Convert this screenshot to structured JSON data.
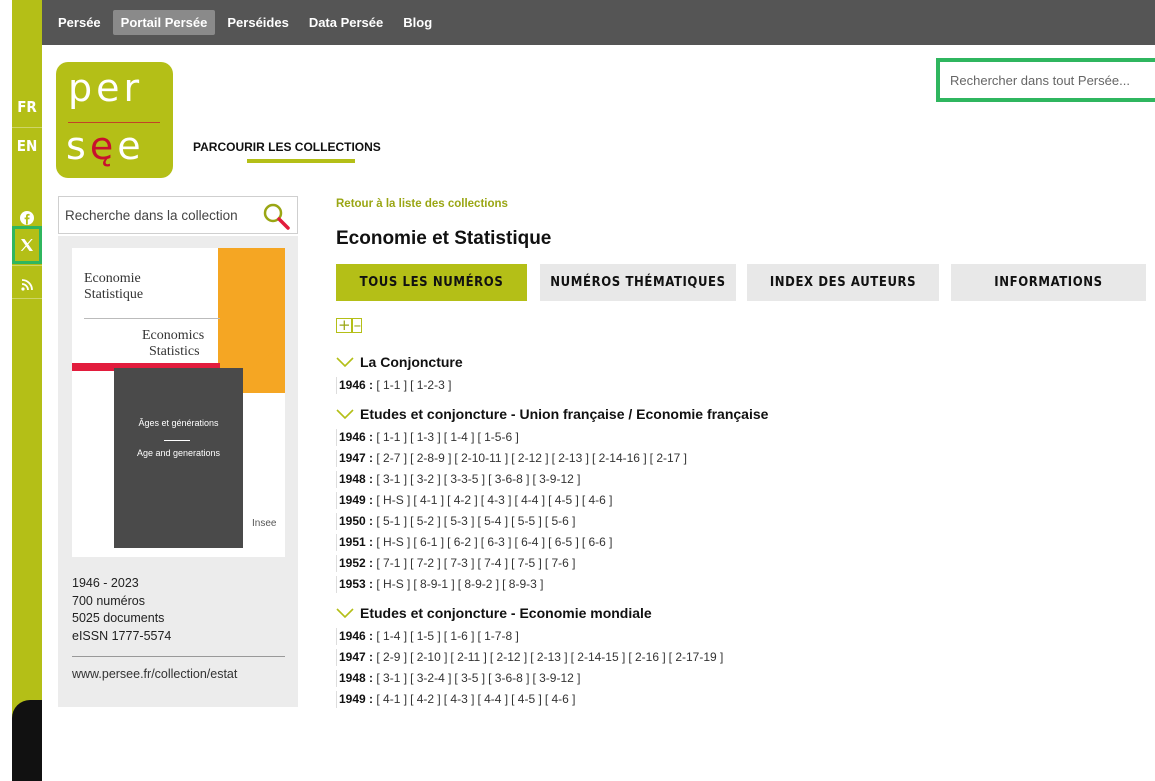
{
  "rail": {
    "lang_fr": "FR",
    "lang_en": "EN"
  },
  "topnav": [
    "Persée",
    "Portail Persée",
    "Perséides",
    "Data Persée",
    "Blog"
  ],
  "logo": {
    "line1": "per",
    "line2_a": "s",
    "line2_b": "ę",
    "line2_c": "e"
  },
  "browse_label": "PARCOURIR LES COLLECTIONS",
  "global_search_placeholder": "Rechercher dans tout Persée...",
  "collection_search_placeholder": "Recherche dans la collection",
  "cover": {
    "title_fr_1": "Economie",
    "title_fr_2": "Statistique",
    "title_en_1": "Economics",
    "title_en_2": "Statistics",
    "theme_fr": "Âges et générations",
    "theme_en": "Age and generations",
    "publisher": "Insee"
  },
  "meta": {
    "years": "1946 - 2023",
    "issues": "700 numéros",
    "documents": "5025 documents",
    "issn": "eISSN 1777-5574",
    "url": "www.persee.fr/collection/estat"
  },
  "back_link": "Retour à la liste des collections",
  "page_title": "Economie et Statistique",
  "tabs": [
    "TOUS LES NUMÉROS",
    "NUMÉROS THÉMATIQUES",
    "INDEX DES AUTEURS",
    "INFORMATIONS"
  ],
  "toggle": {
    "expand": "+",
    "collapse": "–"
  },
  "sections": [
    {
      "title": "La Conjoncture",
      "years": [
        {
          "year": "1946 :",
          "issues": [
            "[ 1-1 ]",
            "[ 1-2-3 ]"
          ]
        }
      ]
    },
    {
      "title": "Etudes et conjoncture - Union française / Economie française",
      "years": [
        {
          "year": "1946 :",
          "issues": [
            "[ 1-1 ]",
            "[ 1-3 ]",
            "[ 1-4 ]",
            "[ 1-5-6 ]"
          ]
        },
        {
          "year": "1947 :",
          "issues": [
            "[ 2-7 ]",
            "[ 2-8-9 ]",
            "[ 2-10-11 ]",
            "[ 2-12 ]",
            "[ 2-13 ]",
            "[ 2-14-16 ]",
            "[ 2-17 ]"
          ]
        },
        {
          "year": "1948 :",
          "issues": [
            "[ 3-1 ]",
            "[ 3-2 ]",
            "[ 3-3-5 ]",
            "[ 3-6-8 ]",
            "[ 3-9-12 ]"
          ]
        },
        {
          "year": "1949 :",
          "issues": [
            "[ H-S ]",
            "[ 4-1 ]",
            "[ 4-2 ]",
            "[ 4-3 ]",
            "[ 4-4 ]",
            "[ 4-5 ]",
            "[ 4-6 ]"
          ]
        },
        {
          "year": "1950 :",
          "issues": [
            "[ 5-1 ]",
            "[ 5-2 ]",
            "[ 5-3 ]",
            "[ 5-4 ]",
            "[ 5-5 ]",
            "[ 5-6 ]"
          ]
        },
        {
          "year": "1951 :",
          "issues": [
            "[ H-S ]",
            "[ 6-1 ]",
            "[ 6-2 ]",
            "[ 6-3 ]",
            "[ 6-4 ]",
            "[ 6-5 ]",
            "[ 6-6 ]"
          ]
        },
        {
          "year": "1952 :",
          "issues": [
            "[ 7-1 ]",
            "[ 7-2 ]",
            "[ 7-3 ]",
            "[ 7-4 ]",
            "[ 7-5 ]",
            "[ 7-6 ]"
          ]
        },
        {
          "year": "1953 :",
          "issues": [
            "[ H-S ]",
            "[ 8-9-1 ]",
            "[ 8-9-2 ]",
            "[ 8-9-3 ]"
          ]
        }
      ]
    },
    {
      "title": "Etudes et conjoncture - Economie mondiale",
      "years": [
        {
          "year": "1946 :",
          "issues": [
            "[ 1-4 ]",
            "[ 1-5 ]",
            "[ 1-6 ]",
            "[ 1-7-8 ]"
          ]
        },
        {
          "year": "1947 :",
          "issues": [
            "[ 2-9 ]",
            "[ 2-10 ]",
            "[ 2-11 ]",
            "[ 2-12 ]",
            "[ 2-13 ]",
            "[ 2-14-15 ]",
            "[ 2-16 ]",
            "[ 2-17-19 ]"
          ]
        },
        {
          "year": "1948 :",
          "issues": [
            "[ 3-1 ]",
            "[ 3-2-4 ]",
            "[ 3-5 ]",
            "[ 3-6-8 ]",
            "[ 3-9-12 ]"
          ]
        },
        {
          "year": "1949 :",
          "issues": [
            "[ 4-1 ]",
            "[ 4-2 ]",
            "[ 4-3 ]",
            "[ 4-4 ]",
            "[ 4-5 ]",
            "[ 4-6 ]"
          ]
        }
      ]
    }
  ],
  "colors": {
    "accent": "#b4bf17",
    "nav": "#555555",
    "highlight": "#2fb65f"
  }
}
